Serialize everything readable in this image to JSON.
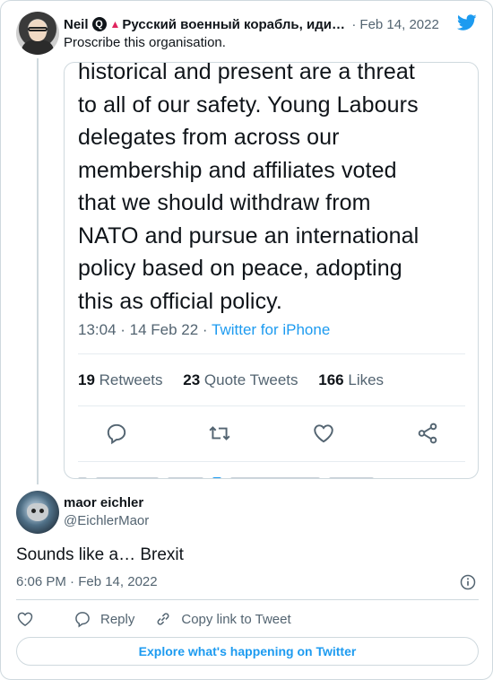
{
  "parent_tweet": {
    "author_name": "Neil",
    "badge_glyph": "Q",
    "handle_marker": "▲",
    "handle_display": "Русский военный корабль, иди ...",
    "date": "Feb 14, 2022",
    "text": "Proscribe this organisation.",
    "embedded_screenshot": {
      "body_lines": [
        "historical and present are a threat",
        "to all of our safety. Young Labours",
        "delegates from across our",
        "membership and affiliates voted",
        "that we should withdraw from",
        "NATO and pursue an international",
        "policy based on peace, adopting",
        "this as official policy."
      ],
      "timestamp": "13:04 · 14 Feb 22 · ",
      "client": "Twitter for iPhone",
      "retweets_count": "19",
      "retweets_label": "Retweets",
      "quote_count": "23",
      "quote_label": "Quote Tweets",
      "likes_count": "166",
      "likes_label": "Likes"
    }
  },
  "reply_tweet": {
    "author_name": "maor eichler",
    "handle": "@EichlerMaor",
    "text": "Sounds like a… Brexit",
    "time": "6:06 PM · Feb 14, 2022"
  },
  "actions": {
    "reply_label": "Reply",
    "copy_link_label": "Copy link to Tweet"
  },
  "explore_label": "Explore what's happening on Twitter",
  "colors": {
    "accent": "#1d9bf0",
    "text_primary": "#0f1419",
    "text_secondary": "#536471",
    "border": "#cfd9de"
  },
  "icons": [
    "twitter-bird-icon",
    "heart-icon",
    "reply-icon",
    "retweet-icon",
    "share-icon",
    "link-icon",
    "info-icon"
  ]
}
